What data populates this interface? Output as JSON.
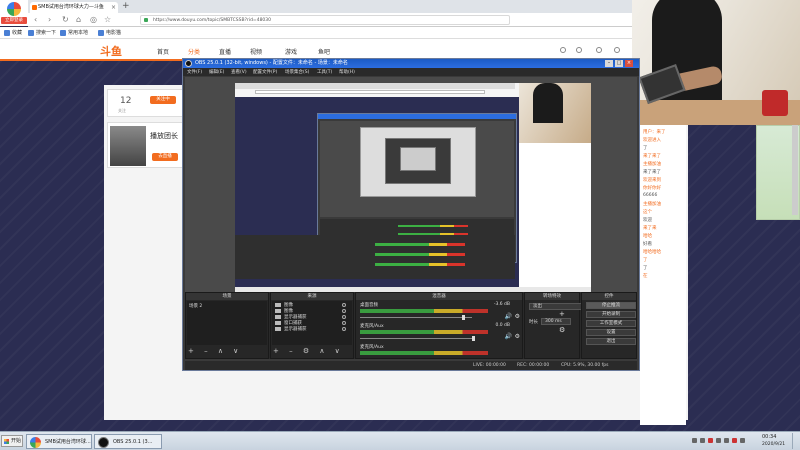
{
  "browser": {
    "logo_label": "立即登录",
    "tab_title": "SMB试用台湾环球大力—斗鱼",
    "tab_close": "×",
    "new_tab": "+",
    "address_url": "https://www.douyu.com/topic/SMBTCSSB?rid=48030",
    "nav": {
      "back": "‹",
      "forward": "›",
      "reload": "↻",
      "home": "⌂",
      "reader": "◎",
      "star": "☆"
    },
    "bookmarks": [
      "收藏",
      "搜索一下",
      "常用本地",
      "电影猫"
    ]
  },
  "site": {
    "logo": "斗鱼",
    "nav": [
      "首页",
      "分类",
      "直播",
      "视频",
      "游戏",
      "鱼吧"
    ],
    "card_count": "12",
    "card_count_sub": "关注",
    "card_btn": "关注中",
    "card2_title": "播放团长",
    "card2_btn": "去直播"
  },
  "chat": {
    "lines": [
      "用户：来了",
      "欢迎进入",
      "了",
      "来了来了",
      "主播加油",
      "来了来了",
      "欢迎来到",
      "你好你好",
      "66666",
      "主播加油",
      "这个",
      "欢迎",
      "来了来",
      "哈哈",
      "好看",
      "哈哈哈哈",
      "了",
      "了",
      "在"
    ]
  },
  "obs": {
    "title": "OBS 25.0.1 (32-bit, windows) - 配置文件：未命名 - 场景：未命名",
    "window_buttons": {
      "minimize": "–",
      "maximize": "□",
      "close": "×"
    },
    "menu": [
      "文件(F)",
      "编辑(E)",
      "查看(V)",
      "配置文件(P)",
      "场景集合(S)",
      "工具(T)",
      "帮助(H)"
    ],
    "docks": {
      "scenes": {
        "header": "场景",
        "items": [
          "场景 2"
        ],
        "footer": "+ – ∧ ∨"
      },
      "sources": {
        "header": "来源",
        "items": [
          "图像",
          "图像",
          "显示器捕获",
          "窗口捕获",
          "显示器捕获"
        ],
        "footer": "+ – ⚙ ∧ ∨"
      },
      "mixer": {
        "header": "混音器",
        "channels": [
          {
            "name": "桌面音频",
            "db": "-3.6 dB"
          },
          {
            "name": "麦克风/Aux",
            "db": "0.0 dB"
          },
          {
            "name": "麦克风/Aux",
            "db": ""
          }
        ],
        "speaker": "🔊",
        "gear": "⚙"
      },
      "transitions": {
        "header": "转场特效",
        "selected": "淡出",
        "controls": "+ – ⚙",
        "duration_label": "时长",
        "duration": "300 ms"
      },
      "controls": {
        "header": "控件",
        "buttons": [
          "停止推流",
          "开始录制",
          "工作室模式",
          "设置",
          "退出"
        ]
      }
    },
    "status": {
      "live": "LIVE: 00:00:00",
      "rec": "REC: 00:00:00",
      "cpu": "CPU: 5.9%, 30.00 fps"
    }
  },
  "taskbar": {
    "start": "开始",
    "items": [
      "SMB试用台湾环球...",
      "OBS 25.0.1 (3..."
    ],
    "time": "00:34",
    "date": "2020/9/21"
  }
}
